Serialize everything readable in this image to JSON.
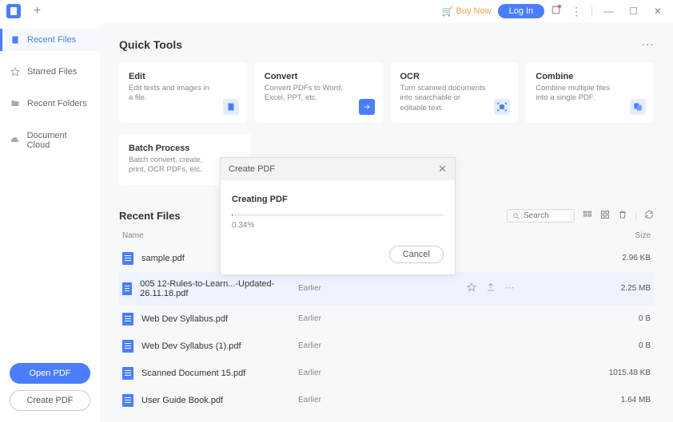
{
  "titlebar": {
    "buy_now": "Buy Now",
    "login": "Log In"
  },
  "sidebar": {
    "items": [
      {
        "label": "Recent Files",
        "icon": "doc"
      },
      {
        "label": "Starred Files",
        "icon": "star"
      },
      {
        "label": "Recent Folders",
        "icon": "folder"
      },
      {
        "label": "Document Cloud",
        "icon": "cloud"
      }
    ],
    "open_pdf": "Open PDF",
    "create_pdf": "Create PDF"
  },
  "quick_tools": {
    "title": "Quick Tools",
    "cards": [
      {
        "title": "Edit",
        "desc": "Edit texts and images in a file."
      },
      {
        "title": "Convert",
        "desc": "Convert PDFs to Word, Excel, PPT, etc."
      },
      {
        "title": "OCR",
        "desc": "Turn scanned documents into searchable or editable text."
      },
      {
        "title": "Combine",
        "desc": "Combine multiple files into a single PDF."
      }
    ],
    "batch": {
      "title": "Batch Process",
      "desc": "Batch convert, create, print, OCR PDFs, etc."
    }
  },
  "recent": {
    "title": "Recent Files",
    "search_placeholder": "Search",
    "header_name": "Name",
    "header_size": "Size",
    "files": [
      {
        "name": "sample.pdf",
        "time": "",
        "size": "2.96 KB"
      },
      {
        "name": "005 12-Rules-to-Learn...-Updated-26.11.18.pdf",
        "time": "Earlier",
        "size": "2.25 MB"
      },
      {
        "name": "Web Dev Syllabus.pdf",
        "time": "Earlier",
        "size": "0 B"
      },
      {
        "name": "Web Dev Syllabus (1).pdf",
        "time": "Earlier",
        "size": "0 B"
      },
      {
        "name": "Scanned Document 15.pdf",
        "time": "Earlier",
        "size": "1015.48 KB"
      },
      {
        "name": "User Guide Book.pdf",
        "time": "Earlier",
        "size": "1.64 MB"
      }
    ]
  },
  "modal": {
    "head": "Create PDF",
    "title": "Creating PDF",
    "percent_text": "0.34%",
    "percent_value": 0.34,
    "cancel": "Cancel"
  }
}
